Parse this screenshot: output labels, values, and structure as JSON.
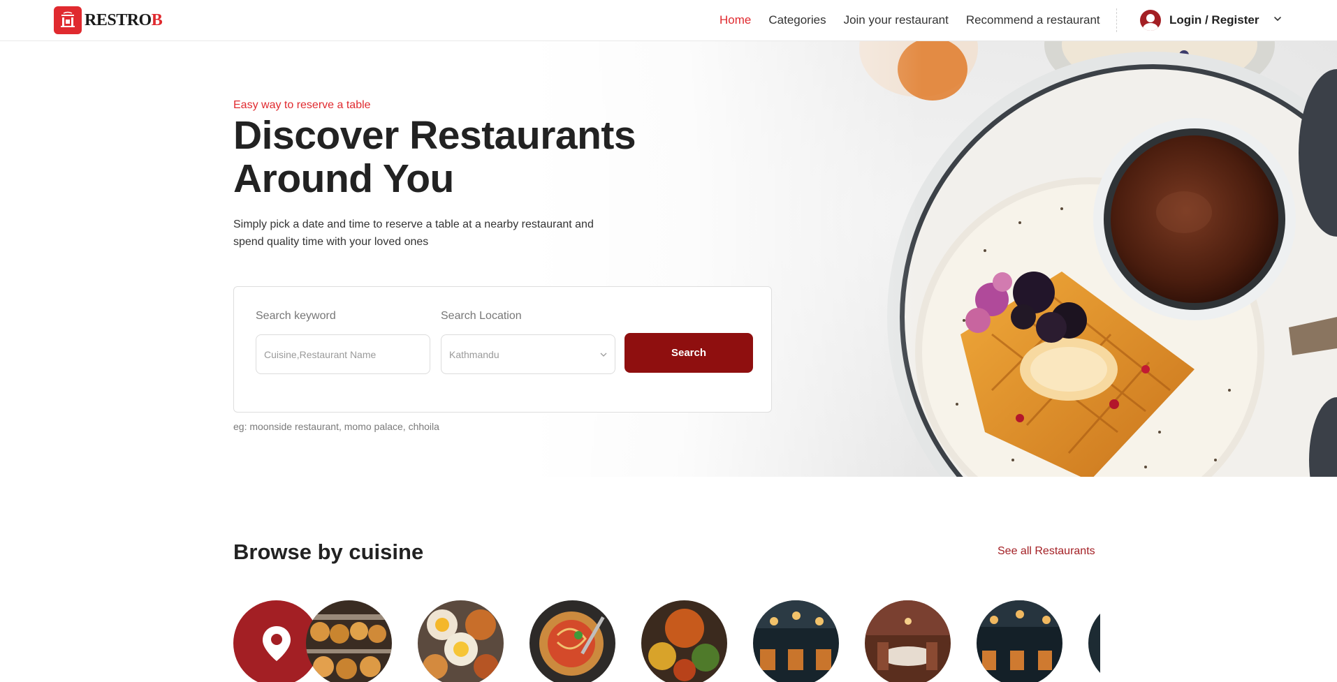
{
  "brand": {
    "name_main": "RESTRO",
    "name_accent": "B",
    "mark_text": "RO",
    "accent_color": "#e02a2f",
    "dark_red": "#8f0f0f"
  },
  "nav": {
    "links": [
      {
        "label": "Home",
        "active": true
      },
      {
        "label": "Categories",
        "active": false
      },
      {
        "label": "Join your restaurant",
        "active": false
      },
      {
        "label": "Recommend a restaurant",
        "active": false
      }
    ],
    "user_label": "Login / Register",
    "icons": {
      "avatar": "user-avatar-icon",
      "chevron": "chevron-down-icon"
    }
  },
  "hero": {
    "eyebrow": "Easy way to reserve a table",
    "title": "Discover Restaurants Around You",
    "subtitle": "Simply pick a date and time to reserve a table at a nearby restaurant and spend quality time with your loved ones",
    "search": {
      "keyword_label": "Search keyword",
      "keyword_placeholder": "Cuisine,Restaurant Name",
      "location_label": "Search Location",
      "location_value": "Kathmandu",
      "button_label": "Search"
    },
    "hint": "eg: moonside restaurant, momo palace, chhoila"
  },
  "browse": {
    "title": "Browse by cuisine",
    "see_all": "See all Restaurants",
    "items": [
      {
        "name": "location",
        "icon": "map-pin-icon"
      },
      {
        "name": "bakery"
      },
      {
        "name": "breakfast-platter"
      },
      {
        "name": "spaghetti"
      },
      {
        "name": "indian-curries"
      },
      {
        "name": "restaurant-interior"
      },
      {
        "name": "dining-room"
      },
      {
        "name": "restaurant-bar"
      },
      {
        "name": "cafe"
      }
    ]
  }
}
